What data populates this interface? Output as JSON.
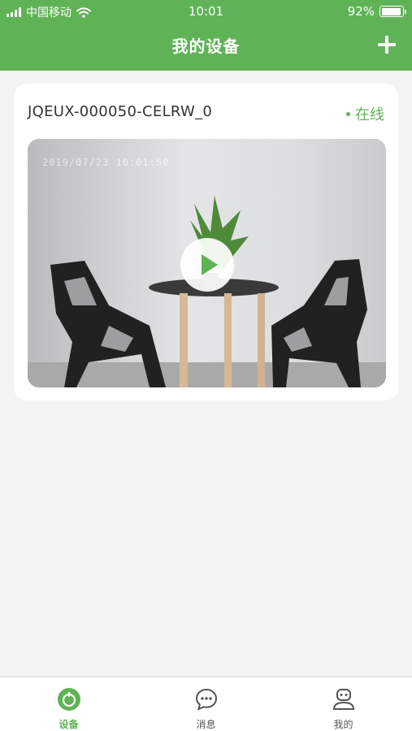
{
  "status_bar": {
    "carrier": "中国移动",
    "time": "10:01",
    "battery_text": "92%",
    "battery_level": 0.92
  },
  "nav": {
    "title": "我的设备",
    "add_icon": "plus-icon"
  },
  "device": {
    "name": "JQEUX-000050-CELRW_0",
    "status": "在线",
    "status_color": "#5fb356",
    "preview_timestamp": "2019/07/23 10:01:50",
    "play_icon": "play-icon"
  },
  "tabs": [
    {
      "label": "设备",
      "icon": "device-icon",
      "active": true
    },
    {
      "label": "消息",
      "icon": "message-icon",
      "active": false
    },
    {
      "label": "我的",
      "icon": "profile-icon",
      "active": false
    }
  ],
  "colors": {
    "brand": "#5fb356",
    "background": "#f4f4f4"
  }
}
